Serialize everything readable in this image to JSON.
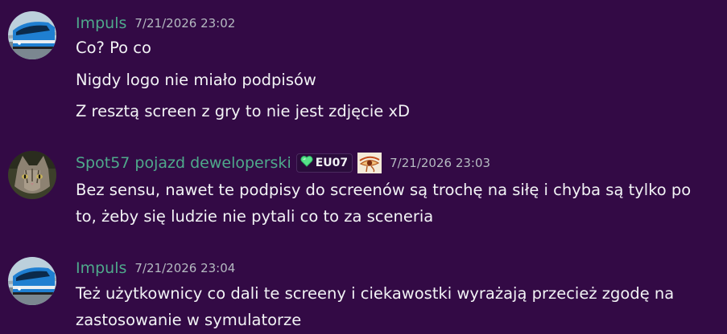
{
  "colors": {
    "background": "#330a45",
    "username": "#4fa98b",
    "timestamp": "#b5bac1",
    "text": "#f2f3f5"
  },
  "messages": [
    {
      "author": "Impuls",
      "timestamp": "7/21/2026 23:02",
      "avatar_icon": "train-avatar-icon",
      "lines": [
        "Co? Po co",
        "Nigdy logo nie miało podpisów",
        "Z resztą screen z gry to nie jest zdjęcie xD"
      ]
    },
    {
      "author": "Spot57 pojazd deweloperski",
      "timestamp": "7/21/2026 23:03",
      "avatar_icon": "cat-avatar-icon",
      "server_tag": {
        "icon": "green-heart-icon",
        "label": "EU07"
      },
      "role_icon": "eye-of-horus-icon",
      "lines": [
        "Bez sensu, nawet te podpisy do screenów są trochę na siłę i chyba są tylko po",
        "to, żeby się ludzie nie pytali co to za sceneria"
      ]
    },
    {
      "author": "Impuls",
      "timestamp": "7/21/2026 23:04",
      "avatar_icon": "train-avatar-icon",
      "lines": [
        "Też użytkownicy co dali te screeny i ciekawostki wyrażają przecież zgodę na",
        "zastosowanie w symulatorze"
      ]
    }
  ]
}
